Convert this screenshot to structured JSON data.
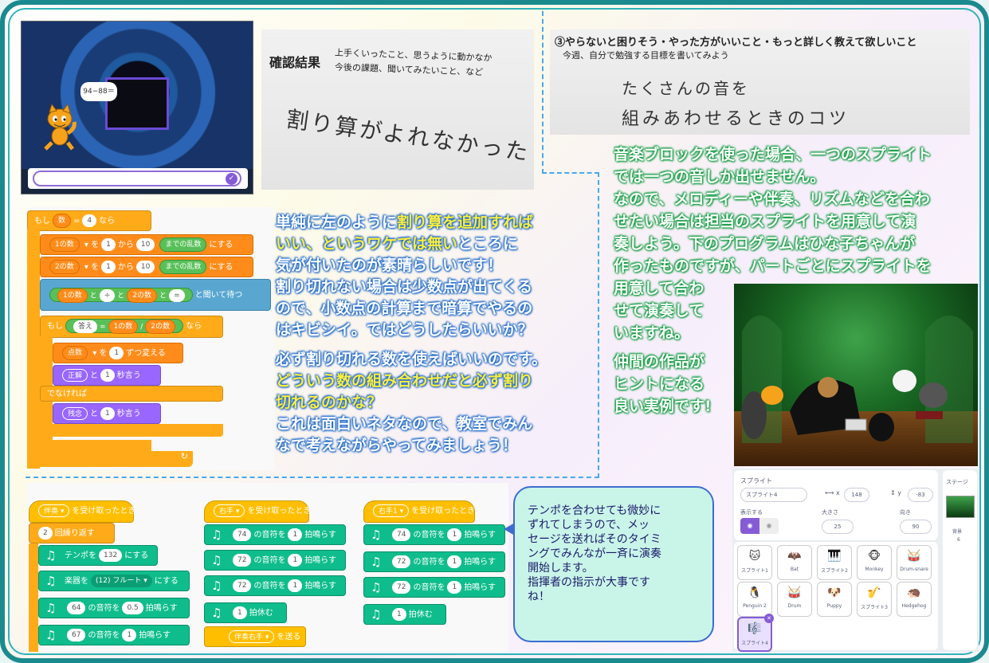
{
  "stage": {
    "speech": "94−88＝"
  },
  "paper1": {
    "title": "確認結果",
    "line1": "上手くいったこと、思うように動かなか",
    "line2": "今後の課題、聞いてみたいこと、など",
    "handwriting": "割り算がよれなかった"
  },
  "paper2": {
    "title": "③やらないと困りそう・やった方がいいこと・もっと詳しく教えて欲しいこと",
    "subtitle": "今週、自分で勉強する目標を書いてみよう",
    "hand1": "たくさんの音を",
    "hand2": "組みあわせるときのコツ"
  },
  "code1": {
    "if1": "もし",
    "var_num": "数",
    "eq": "=",
    "val4": "4",
    "then": "なら",
    "set1_var": "1の数",
    "set_to": "を",
    "from": "1",
    "kara": "から",
    "to": "10",
    "made": "までの乱数",
    "nisuru": "にする",
    "set2_var": "2の数",
    "ask_a": "1の数",
    "and": "と",
    "div": "÷",
    "ask_b": "2の数",
    "ask_eq": "=",
    "ask_wait": "と聞いて待つ",
    "if2": "もし",
    "answer": "答え",
    "ans_a": "1の数",
    "slash": "/",
    "ans_b": "2の数",
    "then2": "なら",
    "score": "点数",
    "score_by": "1",
    "change": "ずつ変える",
    "say1": "正解",
    "say_to": "と",
    "sec1": "1",
    "say_sec": "秒言う",
    "else": "でなければ",
    "say2": "残念",
    "sec2": "1"
  },
  "text_blue": {
    "l1a": "単純に左のように",
    "l1b": "割り算を追加すれば",
    "l2a": "いい、というワケでは無い",
    "l2b": "ところに",
    "l3": "気が付いたのが素晴らしいです！",
    "l4": "割り切れない場合は少数点が出てくる",
    "l5": "ので、小数点の計算まで暗算でやるの",
    "l6": "はキビシイ。ではどうしたらいいか？",
    "l7": "必ず割り切れる数を使えばいいのです。",
    "l8": "どういう数の組み合わせだと必ず割り",
    "l9": "切れるのかな？",
    "l10": "これは面白いネタなので、教室でみん",
    "l11": "なで考えながらやってみましょう！"
  },
  "text_green": {
    "l1": "音楽ブロックを使った場合、一つのスプライト",
    "l2": "では一つの音しか出せません。",
    "l3": "なので、メロディーや伴奏、リズムなどを合わ",
    "l4": "せたい場合は担当のスプライトを用意して演",
    "l5": "奏しよう。下のプログラムはひな子ちゃんが",
    "l6": "作ったものですが、パートごとにスプライトを",
    "l7": "用意して合わ",
    "l8": "せて演奏して",
    "l9": "いますね。",
    "l10": "仲間の作品が",
    "l11": "ヒントになる",
    "l12": "良い実例です!"
  },
  "code2": {
    "col1": {
      "hat_msg": "伴奏",
      "hat": "を受け取ったとき",
      "repeat_n": "2",
      "repeat": "回繰り返す",
      "tempo_l": "テンポを",
      "tempo": "132",
      "tempo_r": "にする",
      "inst_l": "楽器を",
      "inst": "(12) フルート",
      "inst_r": "にする",
      "n1": "64",
      "n1_beats": "0.5",
      "n2": "67",
      "n2_beats": "1",
      "note_l": "の音符を",
      "note_r": "拍鳴らす"
    },
    "col2": {
      "hat_msg": "右手",
      "hat": "を受け取ったとき",
      "n1": "74",
      "n2": "72",
      "n3": "72",
      "b1": "1",
      "b2": "1",
      "b3": "1",
      "rest": "1",
      "rest_l": "拍休む",
      "send_msg": "伴奏右手",
      "send": "を送る"
    },
    "col3": {
      "hat_msg": "右手1",
      "hat": "を受け取ったとき",
      "n1": "74",
      "n2": "72",
      "n3": "72",
      "b1": "1",
      "b2": "1",
      "b3": "1",
      "rest": "1",
      "rest_l": "拍休む"
    }
  },
  "callout": {
    "l1": "テンポを合わせても微妙に",
    "l2": "ずれてしまうので、メッ",
    "l3": "セージを送ればそのタイミ",
    "l4": "ングでみんなが一斉に演奏",
    "l5": "開始します。",
    "l6": "指揮者の指示が大事です",
    "l7": "ね！"
  },
  "sprite_panel": {
    "label": "スプライト",
    "name": "スプライト4",
    "x_label": "x",
    "x": "148",
    "y_label": "y",
    "y": "-83",
    "show_label": "表示する",
    "size_label": "大きさ",
    "size": "25",
    "dir_label": "向き",
    "dir": "90",
    "stage_label": "ステージ",
    "backdrop_label": "背景",
    "backdrop_count": "6",
    "sprites": [
      "スプライト1",
      "Bat",
      "スプライト2",
      "Monkey",
      "Drum-snare",
      "Penguin 2",
      "Drum",
      "Puppy",
      "スプライト3",
      "Hedgehog",
      "スプライト4"
    ]
  }
}
